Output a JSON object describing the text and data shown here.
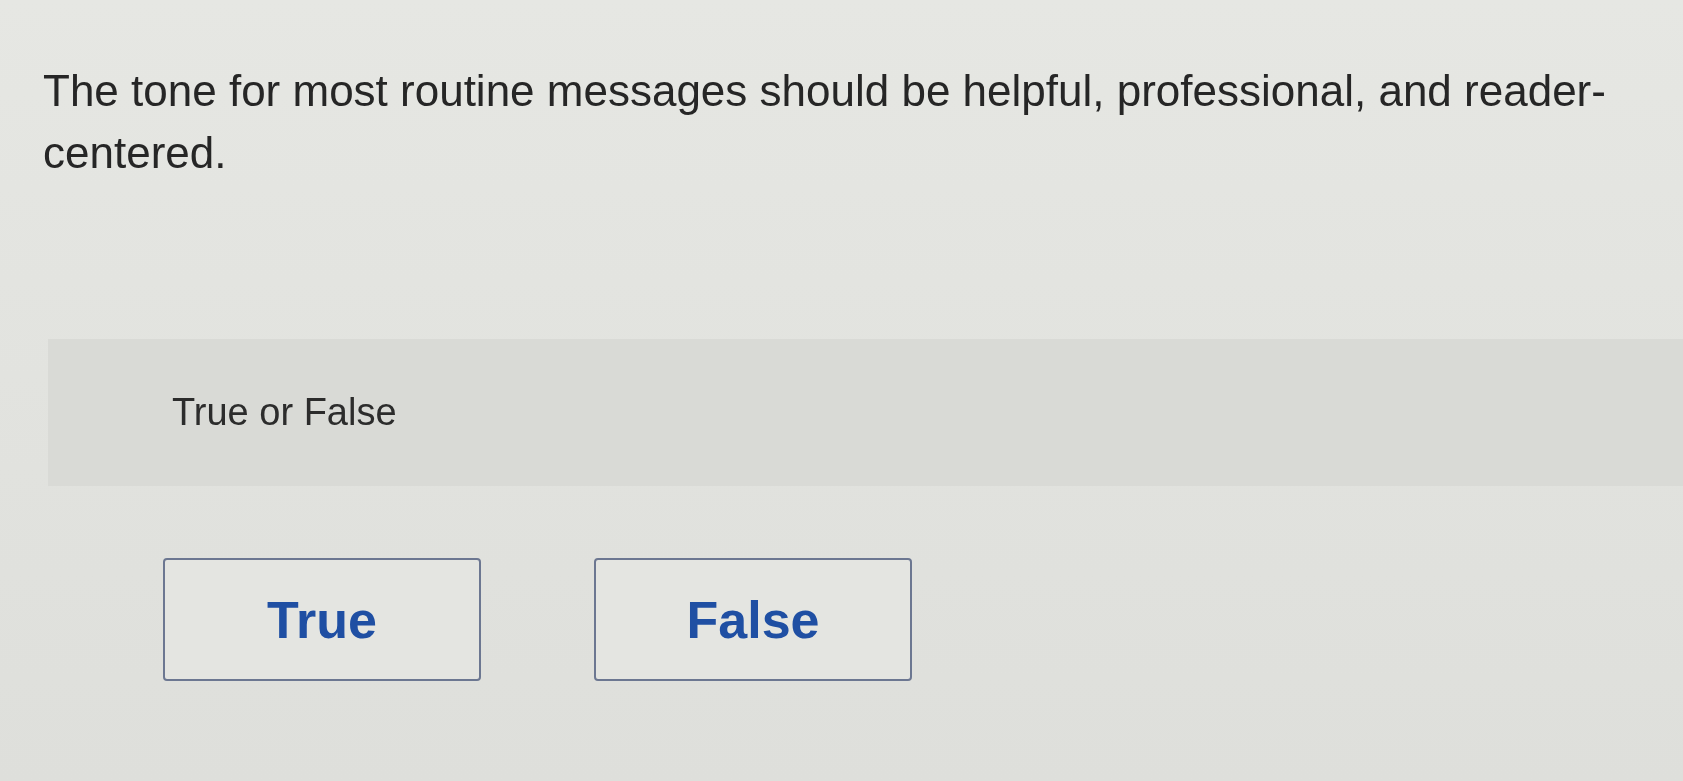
{
  "question": {
    "text": "The tone for most routine messages should be helpful, professional, and reader-centered."
  },
  "prompt_band": {
    "label": "True or False"
  },
  "options": [
    {
      "label": "True",
      "selected": false
    },
    {
      "label": "False",
      "selected": false
    }
  ]
}
